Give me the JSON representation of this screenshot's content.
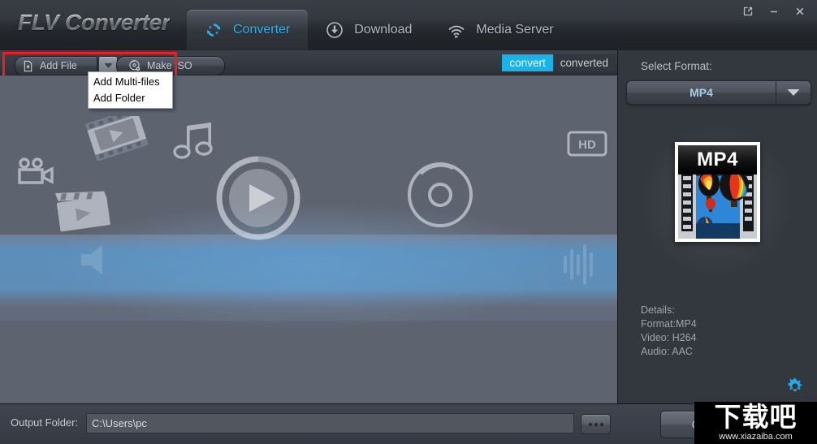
{
  "window": {
    "app_title": "FLV Converter",
    "controls": [
      {
        "name": "restore-icon",
        "label": "↗"
      },
      {
        "name": "minimize-icon",
        "label": "—"
      },
      {
        "name": "close-icon",
        "label": "✕"
      }
    ]
  },
  "tabs": [
    {
      "label": "Converter",
      "icon": "refresh-sync-icon",
      "active": true
    },
    {
      "label": "Download",
      "icon": "download-circle-icon",
      "active": false
    },
    {
      "label": "Media Server",
      "icon": "broadcast-wifi-icon",
      "active": false
    }
  ],
  "toolbar": {
    "add_file_label": "Add File",
    "add_file_icon": "add-document-icon",
    "dropdown_arrow_icon": "caret-down-icon",
    "make_iso_label": "Make ISO",
    "make_iso_icon": "disc-icon",
    "dropdown_items": [
      {
        "label": "Add Multi-files"
      },
      {
        "label": "Add Folder"
      }
    ]
  },
  "convert_tabs": [
    {
      "label": "convert",
      "active": true
    },
    {
      "label": "converted",
      "active": false
    }
  ],
  "format_panel": {
    "select_format_label": "Select Format:",
    "selected_format": "MP4",
    "thumbnail_label": "MP4",
    "details": [
      "Details:",
      "Format:MP4",
      "Video: H264",
      "Audio: AAC"
    ],
    "settings_icon": "gear-icon"
  },
  "bottom_bar": {
    "output_folder_label": "Output Folder:",
    "output_folder_value": "C:\\Users\\pc",
    "output_folder_placeholder": "C:\\Users\\pc",
    "browse_label": "...",
    "open_label": "Open"
  },
  "watermark": {
    "chinese_text": "下载吧",
    "url": "www.xiazaiba.com"
  },
  "colors": {
    "accent_blue": "#2fb4ec",
    "convert_active_bg": "#1bb2ea",
    "highlight_rect": "#ee1d22",
    "panel_bg": "#33373e",
    "list_bg": "#5e6370"
  }
}
